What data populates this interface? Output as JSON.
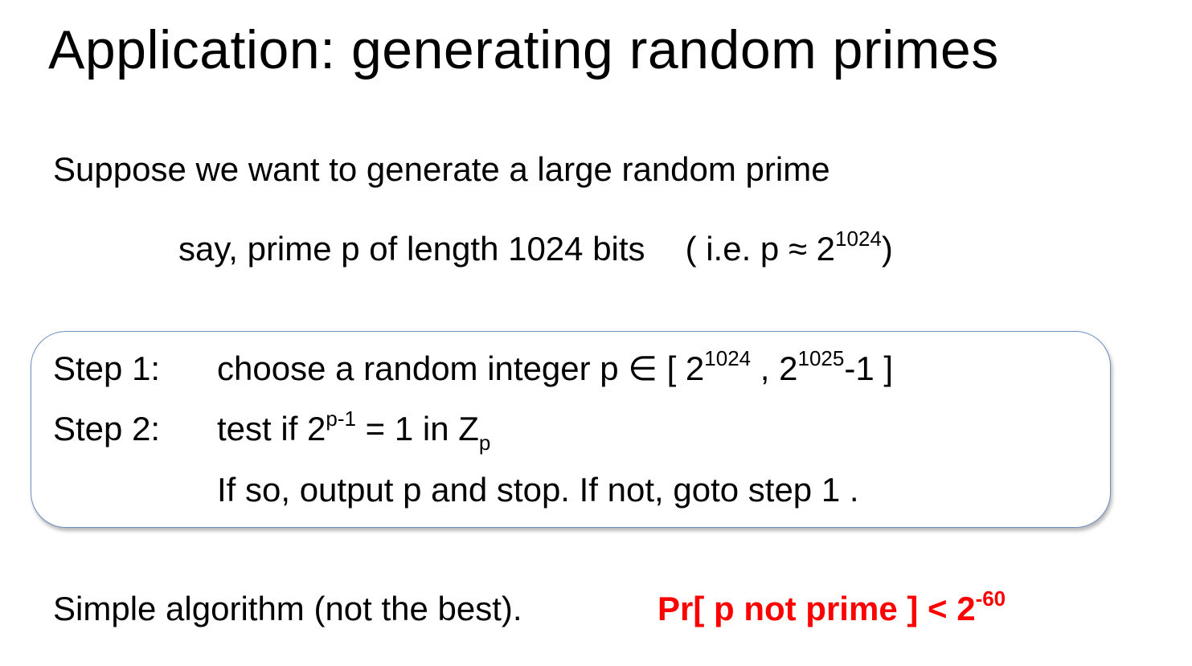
{
  "slide": {
    "title": "Application:  generating random primes",
    "intro": "Suppose we want to generate a large random prime",
    "example": {
      "say": "say, prime  p  of  length 1024 bits",
      "ie_open": "( i.e.   p ≈ 2",
      "ie_exp": "1024",
      "ie_close": ")"
    },
    "steps": {
      "step1": {
        "label": "Step 1:",
        "text_a": "choose a random integer  p ∈ [  2",
        "exp_a": "1024",
        "sep": " ,  2",
        "exp_b": "1025",
        "text_b": "-1 ]"
      },
      "step2": {
        "label": "Step 2:",
        "text_a": "test if   2",
        "exp_a": "p-1",
        "text_b": " = 1   in  Z",
        "sub_b": "p"
      },
      "step3": {
        "text": "If so, output  p  and stop.    If not, goto step 1 ."
      }
    },
    "footer": {
      "left": "Simple algorithm (not the best).",
      "right_text": "Pr[ p not prime ] < 2",
      "right_exp": "-60",
      "right_color": "#ff0000"
    }
  }
}
